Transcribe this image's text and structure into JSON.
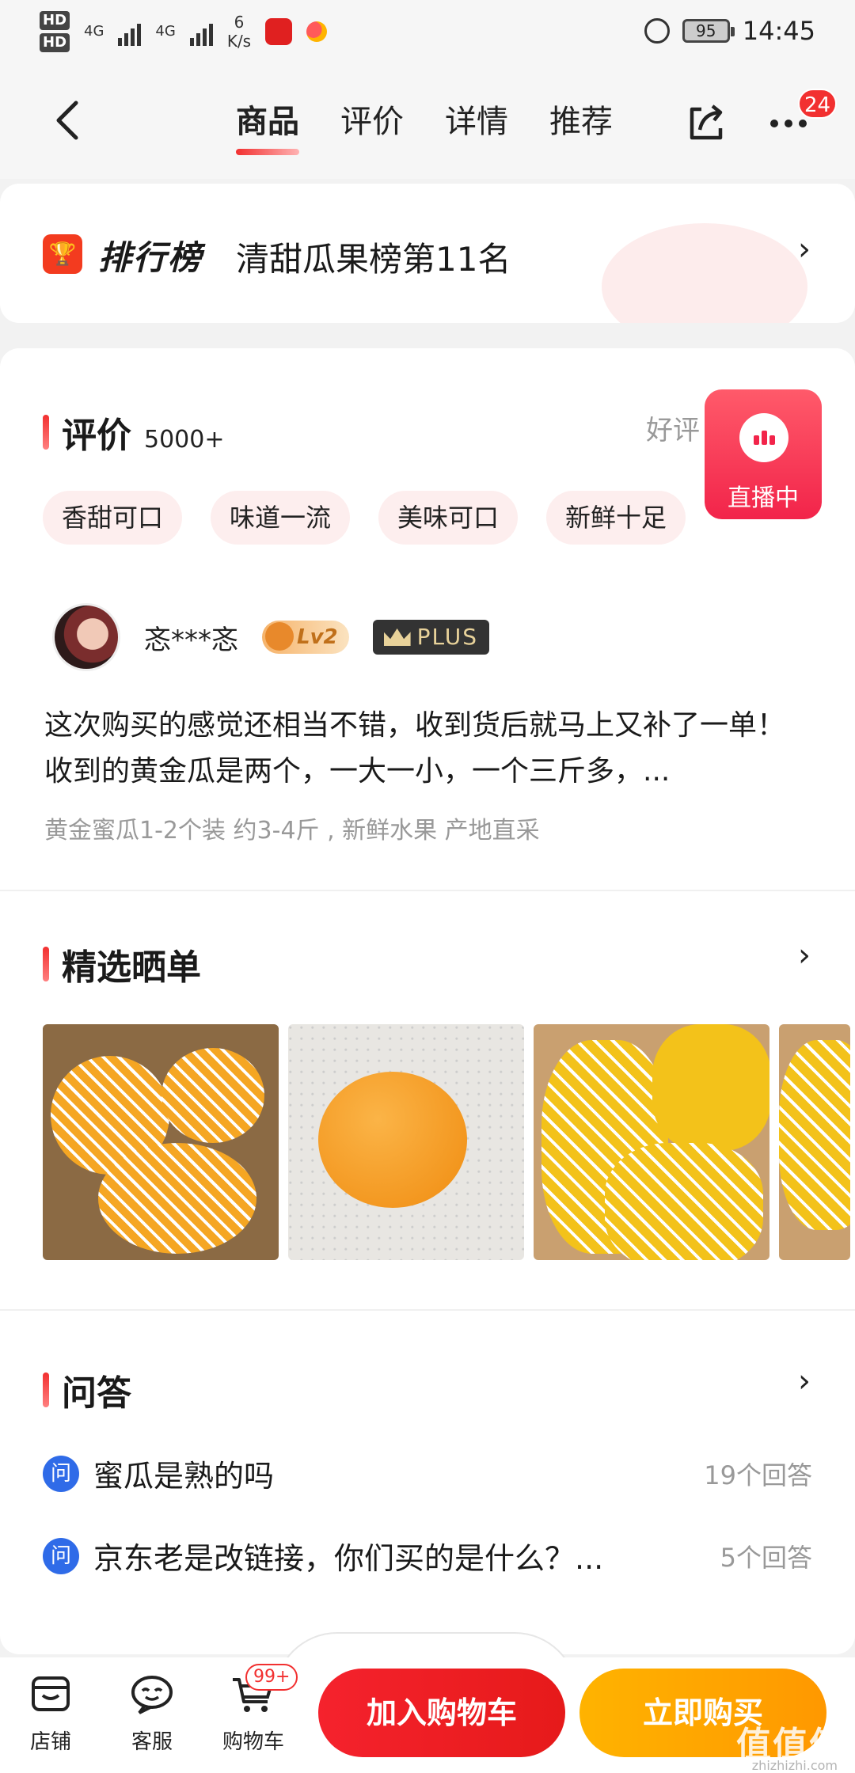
{
  "status_bar": {
    "hd1": "HD",
    "hd2": "HD",
    "net1": "4G",
    "net2": "4G",
    "speed_value": "6",
    "speed_unit": "K/s",
    "battery": "95",
    "time": "14:45"
  },
  "nav": {
    "tabs": [
      "商品",
      "评价",
      "详情",
      "推荐"
    ],
    "badge_count": "24"
  },
  "ranking": {
    "label": "排行榜",
    "text": "清甜瓜果榜第11名",
    "arrow": "›"
  },
  "reviews": {
    "title": "评价",
    "count": "5000+",
    "good_rate_label": "好评",
    "tags": [
      "香甜可口",
      "味道一流",
      "美味可口",
      "新鲜十足"
    ],
    "user_name": "忞***忞",
    "level": "Lv2",
    "plus": "PLUS",
    "text": "这次购买的感觉还相当不错，收到货后就马上又补了一单！收到的黄金瓜是两个，一大一小，一个三斤多，...",
    "sku": "黄金蜜瓜1-2个装 约3-4斤 , 新鲜水果 产地直采"
  },
  "live": {
    "label": "直播中"
  },
  "photos": {
    "title": "精选晒单",
    "arrow": "›"
  },
  "qa": {
    "title": "问答",
    "arrow": "›",
    "icon_char": "问",
    "items": [
      {
        "question": "蜜瓜是熟的吗",
        "answers": "19个回答"
      },
      {
        "question": "京东老是改链接，你们买的是什么？...",
        "answers": "5个回答"
      }
    ]
  },
  "bottom_bar": {
    "shop": "店铺",
    "service": "客服",
    "cart": "购物车",
    "cart_badge": "99+",
    "add_to_cart": "加入购物车",
    "buy_now": "立即购买"
  },
  "watermark": {
    "main": "值值值",
    "sub": "zhizhizhi.com"
  },
  "colors": {
    "accent": "#f23030",
    "buy": "#ff9800",
    "qa_icon": "#2f6be8",
    "live": "#f2244a"
  }
}
